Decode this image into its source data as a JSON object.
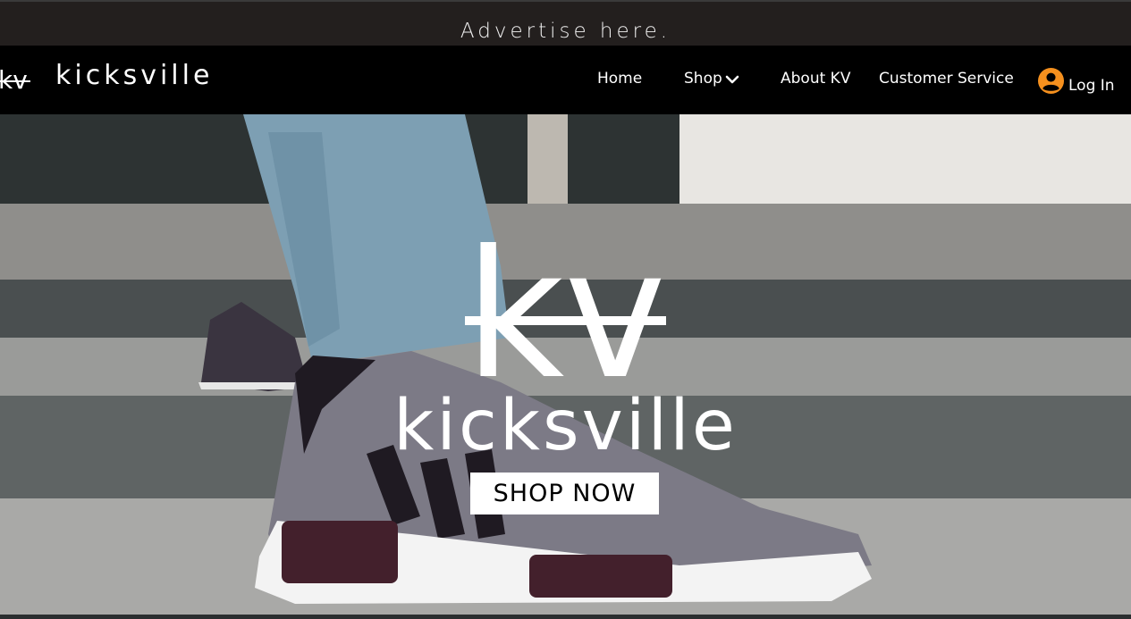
{
  "ad_bar": {
    "text": "Advertise here."
  },
  "header": {
    "logo_text": "kicksville",
    "logo_icon": "kv-logo-icon",
    "nav": {
      "home": "Home",
      "shop": "Shop",
      "about": "About KV",
      "customer_service": "Customer Service"
    },
    "login": {
      "label": "Log In",
      "icon": "user-avatar-icon",
      "accent": "#f5901e"
    }
  },
  "hero": {
    "brand": "kicksville",
    "cta": "SHOP NOW",
    "image": "sneaker-on-steps-photo"
  }
}
